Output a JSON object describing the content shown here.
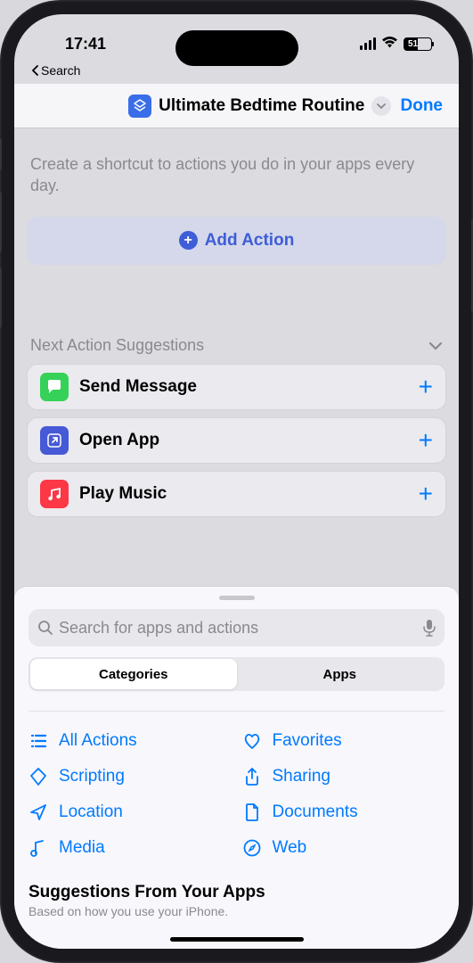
{
  "status": {
    "time": "17:41",
    "battery_pct": "51"
  },
  "back_label": "Search",
  "nav": {
    "title": "Ultimate Bedtime Routine",
    "done": "Done"
  },
  "editor": {
    "instruction": "Create a shortcut to actions you do in your apps every day.",
    "add_action": "Add Action",
    "section": "Next Action Suggestions",
    "suggestions": [
      {
        "label": "Send Message",
        "color": "#35d158",
        "icon": "message"
      },
      {
        "label": "Open App",
        "color": "#4659d6",
        "icon": "open"
      },
      {
        "label": "Play Music",
        "color": "#fc3746",
        "icon": "music"
      }
    ]
  },
  "sheet": {
    "search_placeholder": "Search for apps and actions",
    "segments": [
      "Categories",
      "Apps"
    ],
    "categories": [
      {
        "label": "All Actions",
        "icon": "list"
      },
      {
        "label": "Favorites",
        "icon": "heart"
      },
      {
        "label": "Scripting",
        "icon": "tag"
      },
      {
        "label": "Sharing",
        "icon": "share"
      },
      {
        "label": "Location",
        "icon": "location"
      },
      {
        "label": "Documents",
        "icon": "doc"
      },
      {
        "label": "Media",
        "icon": "note"
      },
      {
        "label": "Web",
        "icon": "compass"
      }
    ],
    "suggestions_title": "Suggestions From Your Apps",
    "suggestions_sub": "Based on how you use your iPhone."
  }
}
